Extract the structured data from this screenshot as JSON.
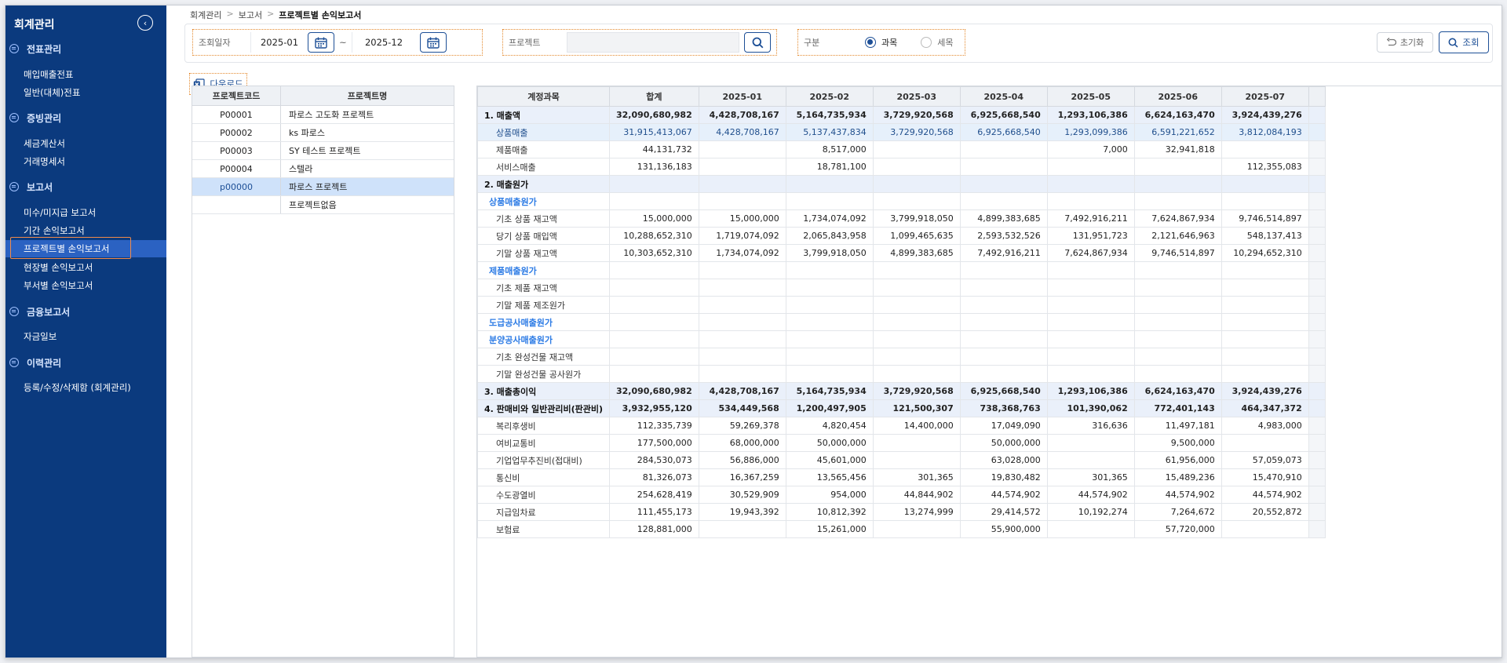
{
  "sidebar": {
    "title": "회계관리",
    "sections": [
      {
        "label": "전표관리",
        "items": [
          "매입매출전표",
          "일반(대체)전표"
        ]
      },
      {
        "label": "증빙관리",
        "items": [
          "세금계산서",
          "거래명세서"
        ]
      },
      {
        "label": "보고서",
        "items": [
          "미수/미지급 보고서",
          "기간 손익보고서",
          "프로젝트별 손익보고서",
          "현장별 손익보고서",
          "부서별 손익보고서"
        ]
      },
      {
        "label": "금융보고서",
        "items": [
          "자금일보"
        ]
      },
      {
        "label": "이력관리",
        "items": [
          "등록/수정/삭제함 (회계관리)"
        ]
      }
    ]
  },
  "breadcrumb": {
    "items": [
      "회계관리",
      "보고서"
    ],
    "separator": ">",
    "current": "프로젝트별 손익보고서"
  },
  "filter": {
    "date_label": "조회일자",
    "date_from": "2025-01",
    "date_sep": "~",
    "date_to": "2025-12",
    "project_label": "프로젝트",
    "project_value": "",
    "type_label": "구분",
    "option_account": "과목",
    "option_detail": "세목",
    "reset_label": "초기화",
    "query_label": "조회"
  },
  "download_label": "다운로드",
  "project_table": {
    "headers": [
      "프로젝트코드",
      "프로젝트명"
    ],
    "rows": [
      {
        "code": "P00001",
        "name": "파로스 고도화 프로젝트"
      },
      {
        "code": "P00002",
        "name": "ks 파로스"
      },
      {
        "code": "P00003",
        "name": "SY 테스트 프로젝트"
      },
      {
        "code": "P00004",
        "name": "스텔라"
      },
      {
        "code": "p00000",
        "name": "파로스 프로젝트"
      },
      {
        "code": "",
        "name": "프로젝트없음"
      }
    ]
  },
  "report": {
    "headers": [
      "계정과목",
      "합계",
      "2025-01",
      "2025-02",
      "2025-03",
      "2025-04",
      "2025-05",
      "2025-06",
      "2025-07"
    ],
    "rows": [
      {
        "type": "sec",
        "cells": [
          "1. 매출액",
          "32,090,680,982",
          "4,428,708,167",
          "5,164,735,934",
          "3,729,920,568",
          "6,925,668,540",
          "1,293,106,386",
          "6,624,163,470",
          "3,924,439,276"
        ]
      },
      {
        "type": "hl",
        "cells": [
          "상품매출",
          "31,915,413,067",
          "4,428,708,167",
          "5,137,437,834",
          "3,729,920,568",
          "6,925,668,540",
          "1,293,099,386",
          "6,591,221,652",
          "3,812,084,193"
        ]
      },
      {
        "type": "sub",
        "cells": [
          "제품매출",
          "44,131,732",
          "",
          "8,517,000",
          "",
          "",
          "7,000",
          "32,941,818",
          ""
        ]
      },
      {
        "type": "sub",
        "cells": [
          "서비스매출",
          "131,136,183",
          "",
          "18,781,100",
          "",
          "",
          "",
          "",
          "112,355,083"
        ]
      },
      {
        "type": "sec",
        "cells": [
          "2. 매출원가",
          "",
          "",
          "",
          "",
          "",
          "",
          "",
          ""
        ]
      },
      {
        "type": "grp",
        "cells": [
          "상품매출원가",
          "",
          "",
          "",
          "",
          "",
          "",
          "",
          ""
        ]
      },
      {
        "type": "sub",
        "cells": [
          "기초 상품 재고액",
          "15,000,000",
          "15,000,000",
          "1,734,074,092",
          "3,799,918,050",
          "4,899,383,685",
          "7,492,916,211",
          "7,624,867,934",
          "9,746,514,897"
        ]
      },
      {
        "type": "sub",
        "cells": [
          "당기 상품 매입액",
          "10,288,652,310",
          "1,719,074,092",
          "2,065,843,958",
          "1,099,465,635",
          "2,593,532,526",
          "131,951,723",
          "2,121,646,963",
          "548,137,413"
        ]
      },
      {
        "type": "sub",
        "cells": [
          "기말 상품 재고액",
          "10,303,652,310",
          "1,734,074,092",
          "3,799,918,050",
          "4,899,383,685",
          "7,492,916,211",
          "7,624,867,934",
          "9,746,514,897",
          "10,294,652,310"
        ]
      },
      {
        "type": "grp",
        "cells": [
          "제품매출원가",
          "",
          "",
          "",
          "",
          "",
          "",
          "",
          ""
        ]
      },
      {
        "type": "sub",
        "cells": [
          "기초 제품 재고액",
          "",
          "",
          "",
          "",
          "",
          "",
          "",
          ""
        ]
      },
      {
        "type": "sub",
        "cells": [
          "기말 제품 제조원가",
          "",
          "",
          "",
          "",
          "",
          "",
          "",
          ""
        ]
      },
      {
        "type": "grp",
        "cells": [
          "도급공사매출원가",
          "",
          "",
          "",
          "",
          "",
          "",
          "",
          ""
        ]
      },
      {
        "type": "grp",
        "cells": [
          "분양공사매출원가",
          "",
          "",
          "",
          "",
          "",
          "",
          "",
          ""
        ]
      },
      {
        "type": "sub",
        "cells": [
          "기초 완성건물 재고액",
          "",
          "",
          "",
          "",
          "",
          "",
          "",
          ""
        ]
      },
      {
        "type": "sub",
        "cells": [
          "기말 완성건물 공사원가",
          "",
          "",
          "",
          "",
          "",
          "",
          "",
          ""
        ]
      },
      {
        "type": "sec",
        "cells": [
          "3. 매출총이익",
          "32,090,680,982",
          "4,428,708,167",
          "5,164,735,934",
          "3,729,920,568",
          "6,925,668,540",
          "1,293,106,386",
          "6,624,163,470",
          "3,924,439,276"
        ]
      },
      {
        "type": "sec",
        "cells": [
          "4. 판매비와 일반관리비(판관비)",
          "3,932,955,120",
          "534,449,568",
          "1,200,497,905",
          "121,500,307",
          "738,368,763",
          "101,390,062",
          "772,401,143",
          "464,347,372"
        ]
      },
      {
        "type": "sub",
        "cells": [
          "복리후생비",
          "112,335,739",
          "59,269,378",
          "4,820,454",
          "14,400,000",
          "17,049,090",
          "316,636",
          "11,497,181",
          "4,983,000"
        ]
      },
      {
        "type": "sub",
        "cells": [
          "여비교통비",
          "177,500,000",
          "68,000,000",
          "50,000,000",
          "",
          "50,000,000",
          "",
          "9,500,000",
          ""
        ]
      },
      {
        "type": "sub",
        "cells": [
          "기업업무추진비(접대비)",
          "284,530,073",
          "56,886,000",
          "45,601,000",
          "",
          "63,028,000",
          "",
          "61,956,000",
          "57,059,073"
        ]
      },
      {
        "type": "sub",
        "cells": [
          "통신비",
          "81,326,073",
          "16,367,259",
          "13,565,456",
          "301,365",
          "19,830,482",
          "301,365",
          "15,489,236",
          "15,470,910"
        ]
      },
      {
        "type": "sub",
        "cells": [
          "수도광열비",
          "254,628,419",
          "30,529,909",
          "954,000",
          "44,844,902",
          "44,574,902",
          "44,574,902",
          "44,574,902",
          "44,574,902"
        ]
      },
      {
        "type": "sub",
        "cells": [
          "지급임차료",
          "111,455,173",
          "19,943,392",
          "10,812,392",
          "13,274,999",
          "29,414,572",
          "10,192,274",
          "7,264,672",
          "20,552,872"
        ]
      },
      {
        "type": "sub",
        "cells": [
          "보험료",
          "128,881,000",
          "",
          "15,261,000",
          "",
          "55,900,000",
          "",
          "57,720,000",
          ""
        ]
      }
    ]
  }
}
